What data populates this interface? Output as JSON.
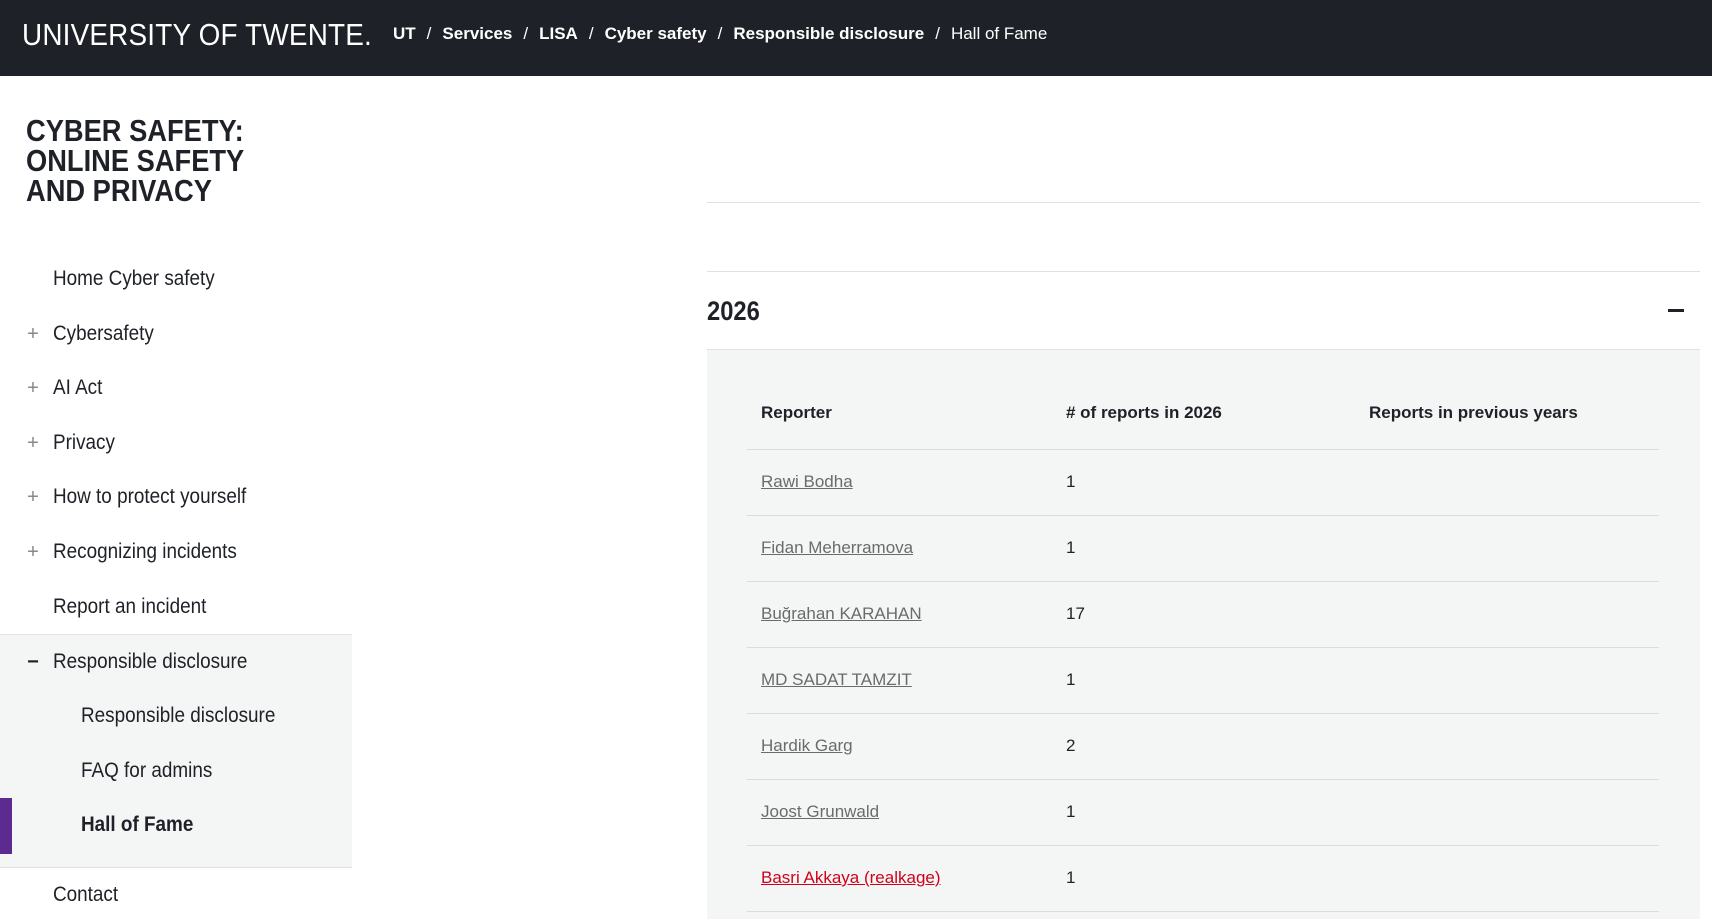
{
  "header": {
    "logo": "UNIVERSITY OF TWENTE.",
    "breadcrumb": [
      "UT",
      "Services",
      "LISA",
      "Cyber safety",
      "Responsible disclosure",
      "Hall of Fame"
    ],
    "separator": "/"
  },
  "sidebar": {
    "title": "CYBER SAFETY: ONLINE SAFETY AND PRIVACY",
    "items": [
      {
        "label": "Home Cyber safety",
        "toggle": ""
      },
      {
        "label": "Cybersafety",
        "toggle": "+"
      },
      {
        "label": "AI Act",
        "toggle": "+"
      },
      {
        "label": "Privacy",
        "toggle": "+"
      },
      {
        "label": "How to protect yourself",
        "toggle": "+"
      },
      {
        "label": "Recognizing incidents",
        "toggle": "+"
      },
      {
        "label": "Report an incident",
        "toggle": ""
      },
      {
        "label": "Responsible disclosure",
        "toggle": "−"
      }
    ],
    "subitems": [
      {
        "label": "Responsible disclosure"
      },
      {
        "label": "FAQ for admins"
      },
      {
        "label": "Hall of Fame",
        "active": true
      }
    ],
    "contact": "Contact"
  },
  "main": {
    "year": "2026",
    "table": {
      "headers": [
        "Reporter",
        "# of reports in 2026",
        "Reports in previous years"
      ],
      "rows": [
        {
          "reporter": "Rawi Bodha",
          "reports": "1",
          "previous": ""
        },
        {
          "reporter": "Fidan Meherramova ",
          "reports": "1",
          "previous": ""
        },
        {
          "reporter": "Buğrahan KARAHAN",
          "reports": "17",
          "previous": ""
        },
        {
          "reporter": "MD SADAT TAMZIT",
          "reports": "1",
          "previous": ""
        },
        {
          "reporter": "Hardik Garg",
          "reports": "2",
          "previous": ""
        },
        {
          "reporter": "Joost Grunwald",
          "reports": "1",
          "previous": ""
        },
        {
          "reporter": "Basri Akkaya (realkage)",
          "reports": "1",
          "previous": "",
          "highlight": true
        }
      ]
    }
  },
  "colors": {
    "topbar": "#1e2127",
    "accent_purple": "#5c2b8f",
    "link_gray": "#6b6b6b",
    "link_red": "#d0021b",
    "panel_bg": "#f4f5f5"
  }
}
